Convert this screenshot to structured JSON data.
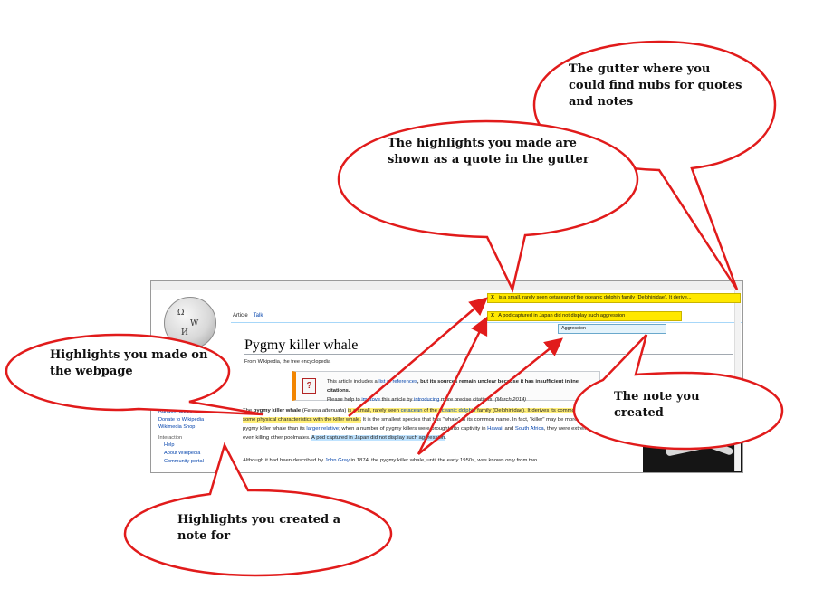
{
  "page": {
    "tabs": {
      "article": "Article",
      "talk": "Talk"
    },
    "title": "Pygmy killer whale",
    "from": "From Wikipedia, the free encyclopedia",
    "notice": {
      "icon": "?",
      "line1a": "This article includes a ",
      "line1_link": "list of references",
      "line1b": ", but its sources remain unclear because it has insufficient inline citations.",
      "line2a": "Please help to ",
      "line2_link1": "improve",
      "line2b": " this article by ",
      "line2_link2": "introducing",
      "line2c": " more precise citations.",
      "date": "(March 2014)"
    },
    "sidebar": {
      "items1": [
        "Random article",
        "Donate to Wikipedia",
        "Wikimedia Shop"
      ],
      "heading": "Interaction",
      "items2": [
        "Help",
        "About Wikipedia",
        "Community portal"
      ]
    },
    "para1": {
      "a": "The ",
      "b": "pygmy killer whale",
      "c": " (",
      "d": "Feresa attenuata",
      "e": ") ",
      "hl1": "is a small, rarely seen ",
      "hl1_link1": "cetacean",
      "hl1_mid": " of the ",
      "hl1_link2": "oceanic dolphin",
      "hl1_end": " family (Delphinidae). It derives its common name from sharing some physical characteristics with the killer whale.",
      "f": " It is the smallest species that has \"whale\" in its common name. In fact, \"killer\" may be more apt in the case of the pygmy killer whale than its ",
      "link_larger": "larger relative",
      "g": "; when a number of pygmy killers were brought into captivity in ",
      "link_hawaii": "Hawaii",
      "h": " and ",
      "link_sa": "South Africa",
      "i": ", they were extremely aggressive—even killing other poolmates. ",
      "hl2": "A pod captured in Japan did not display such aggression",
      "j": "."
    },
    "para2": {
      "a": "Although it had been described by ",
      "link": "John Gray",
      "b": " in 1874, the pygmy killer whale, until the early 1950s, was known only from two"
    }
  },
  "gutter": {
    "quote1": {
      "x": "X",
      "text": "is a small, rarely seen cetacean of the oceanic dolphin family (Delphinidae). It derive..."
    },
    "quote2": {
      "x": "X",
      "text": "A pod captured in Japan did not display such aggression"
    },
    "note": "Aggression"
  },
  "callouts": {
    "gutter": "The gutter where you could find nubs for quotes and notes",
    "highlights_quote": "The highlights you made are shown as a quote in the gutter",
    "highlights_page": "Highlights you made on the webpage",
    "note_created": "The note you created",
    "note_for": "Highlights you created a note for"
  },
  "colors": {
    "callout_stroke": "#e11b1b",
    "quote_bg": "#ffe800",
    "note_bg": "#e4f3fb",
    "highlight_yellow": "#ffef7a",
    "highlight_blue": "#bfe3ff",
    "link": "#0645ad"
  }
}
